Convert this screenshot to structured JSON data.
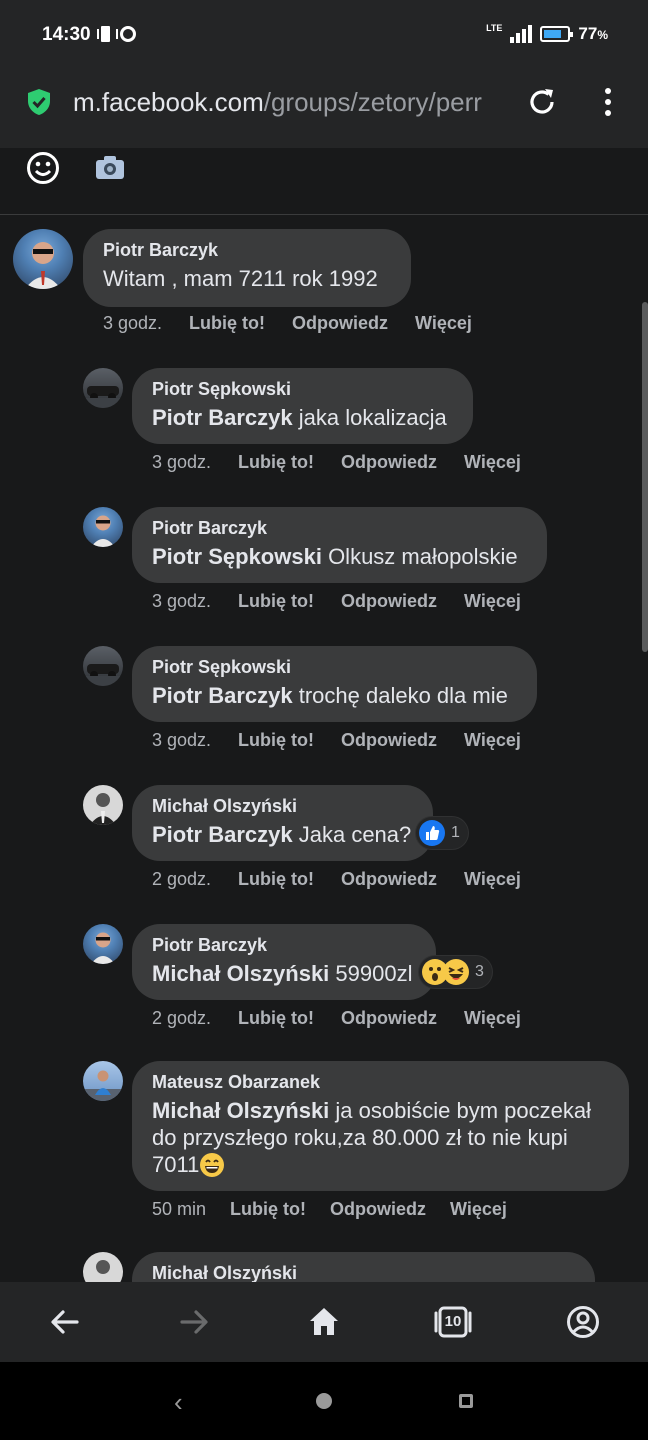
{
  "status_bar": {
    "time": "14:30",
    "network": "LTE",
    "battery_percent": "77",
    "battery_unit": "%",
    "battery_level": 0.77
  },
  "browser": {
    "url_host": "m.facebook.com",
    "url_path": "/groups/zetory/perr",
    "secure_color": "#2ecc71"
  },
  "actions_labels": {
    "like": "Lubię to!",
    "reply": "Odpowiedz",
    "more": "Więcej"
  },
  "comments": [
    {
      "author": "Piotr Barczyk",
      "mention": "",
      "text": "Witam , mam 7211 rok 1992",
      "time": "3 godz."
    },
    {
      "author": "Piotr Sępkowski",
      "mention": "Piotr Barczyk",
      "text": " jaka lokalizacja",
      "time": "3 godz."
    },
    {
      "author": "Piotr Barczyk",
      "mention": "Piotr Sępkowski",
      "text": " Olkusz małopolskie",
      "time": "3 godz."
    },
    {
      "author": "Piotr Sępkowski",
      "mention": "Piotr Barczyk",
      "text": " trochę daleko dla mie",
      "time": "3 godz."
    },
    {
      "author": "Michał Olszyński",
      "mention": "Piotr Barczyk",
      "text": " Jaka cena?",
      "time": "2 godz.",
      "reaction_count": "1"
    },
    {
      "author": "Piotr Barczyk",
      "mention": "Michał Olszyński",
      "text": " 59900zl",
      "time": "2 godz.",
      "reaction_count": "3"
    },
    {
      "author": "Mateusz Obarzanek",
      "mention": "Michał Olszyński",
      "text_line1": " ja osobiście bym poczekał",
      "text_line2": "do przyszłego roku,za 80.000 zł to nie kupi",
      "text_line3": "7011",
      "time": "50 min"
    },
    {
      "author": "Michał Olszyński"
    }
  ],
  "bottom_nav": {
    "tab_count": "10"
  }
}
